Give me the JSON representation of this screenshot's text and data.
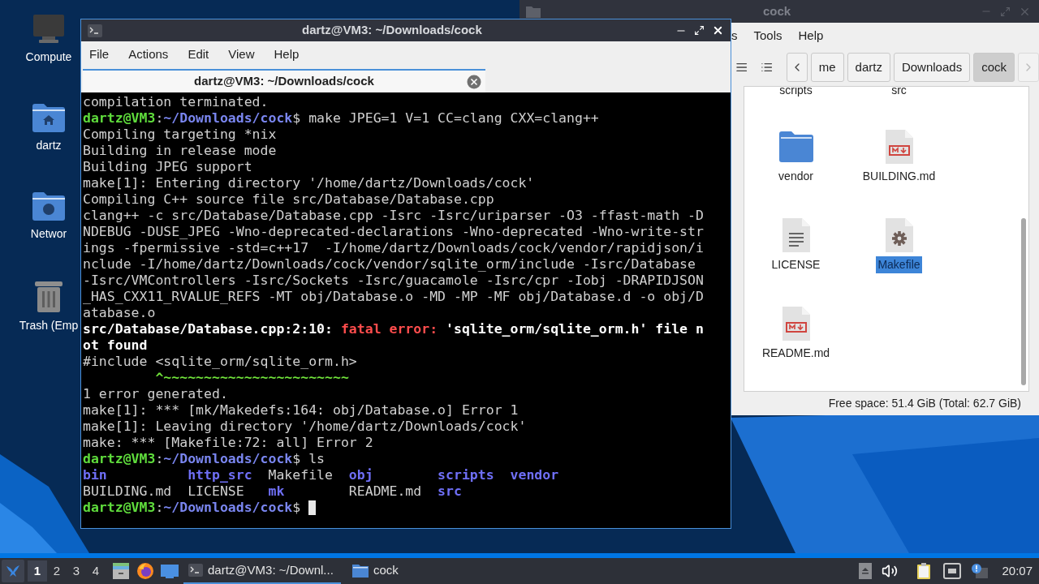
{
  "desktop_icons": [
    {
      "label": "Compute",
      "kind": "computer"
    },
    {
      "label": "dartz",
      "kind": "home"
    },
    {
      "label": "Networ",
      "kind": "network"
    },
    {
      "label": "Trash (Emp",
      "kind": "trash"
    }
  ],
  "file_manager": {
    "title": "cock",
    "menu": [
      "s",
      "Tools",
      "Help"
    ],
    "breadcrumbs": [
      {
        "label": "me",
        "selected": false
      },
      {
        "label": "dartz",
        "selected": false
      },
      {
        "label": "Downloads",
        "selected": false
      },
      {
        "label": "cock",
        "selected": true
      }
    ],
    "files": [
      {
        "name": "scripts",
        "kind": "label_only",
        "selected": false
      },
      {
        "name": "src",
        "kind": "label_only",
        "selected": false
      },
      {
        "name": "vendor",
        "kind": "folder",
        "selected": false
      },
      {
        "name": "BUILDING.md",
        "kind": "markdown",
        "selected": false
      },
      {
        "name": "LICENSE",
        "kind": "text",
        "selected": false
      },
      {
        "name": "Makefile",
        "kind": "makefile",
        "selected": true
      },
      {
        "name": "README.md",
        "kind": "markdown",
        "selected": false
      }
    ],
    "status": "Free space: 51.4 GiB (Total: 62.7 GiB)"
  },
  "terminal": {
    "title": "dartz@VM3: ~/Downloads/cock",
    "menu": [
      "File",
      "Actions",
      "Edit",
      "View",
      "Help"
    ],
    "tabs": [
      {
        "label": "dartz@VM3: ~/Downloads/cock",
        "selected": true
      }
    ],
    "lines": [
      [
        {
          "text": "compilation terminated.",
          "kind": "plain"
        }
      ],
      [
        {
          "text": "dartz@VM3",
          "kind": "user"
        },
        {
          "text": ":",
          "kind": "plain"
        },
        {
          "text": "~/Downloads/cock",
          "kind": "path"
        },
        {
          "text": "$ make JPEG=1 V=1 CC=clang CXX=clang++",
          "kind": "plain"
        }
      ],
      [
        {
          "text": "Compiling targeting *nix",
          "kind": "plain"
        }
      ],
      [
        {
          "text": "Building in release mode",
          "kind": "plain"
        }
      ],
      [
        {
          "text": "Building JPEG support",
          "kind": "plain"
        }
      ],
      [
        {
          "text": "make[1]: Entering directory '/home/dartz/Downloads/cock'",
          "kind": "plain"
        }
      ],
      [
        {
          "text": "Compiling C++ source file src/Database/Database.cpp",
          "kind": "plain"
        }
      ],
      [
        {
          "text": "clang++ -c src/Database/Database.cpp -Isrc -Isrc/uriparser -O3 -ffast-math -D",
          "kind": "plain"
        }
      ],
      [
        {
          "text": "NDEBUG -DUSE_JPEG -Wno-deprecated-declarations -Wno-deprecated -Wno-write-str",
          "kind": "plain"
        }
      ],
      [
        {
          "text": "ings -fpermissive -std=c++17  -I/home/dartz/Downloads/cock/vendor/rapidjson/i",
          "kind": "plain"
        }
      ],
      [
        {
          "text": "nclude -I/home/dartz/Downloads/cock/vendor/sqlite_orm/include -Isrc/Database",
          "kind": "plain"
        }
      ],
      [
        {
          "text": "-Isrc/VMControllers -Isrc/Sockets -Isrc/guacamole -Isrc/cpr -Iobj -DRAPIDJSON",
          "kind": "plain"
        }
      ],
      [
        {
          "text": "_HAS_CXX11_RVALUE_REFS -MT obj/Database.o -MD -MP -MF obj/Database.d -o obj/D",
          "kind": "plain"
        }
      ],
      [
        {
          "text": "atabase.o",
          "kind": "plain"
        }
      ],
      [
        {
          "text": "src/Database/Database.cpp:2:10: ",
          "kind": "bold"
        },
        {
          "text": "fatal error: ",
          "kind": "error"
        },
        {
          "text": "'sqlite_orm/sqlite_orm.h' file n",
          "kind": "bold"
        }
      ],
      [
        {
          "text": "ot found",
          "kind": "bold"
        }
      ],
      [
        {
          "text": "#include <sqlite_orm/sqlite_orm.h>",
          "kind": "plain"
        }
      ],
      [
        {
          "text": "         ^~~~~~~~~~~~~~~~~~~~~~~~",
          "kind": "caret"
        }
      ],
      [
        {
          "text": "1 error generated.",
          "kind": "plain"
        }
      ],
      [
        {
          "text": "make[1]: *** [mk/Makedefs:164: obj/Database.o] Error 1",
          "kind": "plain"
        }
      ],
      [
        {
          "text": "make[1]: Leaving directory '/home/dartz/Downloads/cock'",
          "kind": "plain"
        }
      ],
      [
        {
          "text": "make: *** [Makefile:72: all] Error 2",
          "kind": "plain"
        }
      ],
      [
        {
          "text": "dartz@VM3",
          "kind": "user"
        },
        {
          "text": ":",
          "kind": "plain"
        },
        {
          "text": "~/Downloads/cock",
          "kind": "path"
        },
        {
          "text": "$ ls",
          "kind": "plain"
        }
      ],
      [
        {
          "text": "bin          ",
          "kind": "dir"
        },
        {
          "text": "http_src  ",
          "kind": "dir"
        },
        {
          "text": "Makefile  ",
          "kind": "plain"
        },
        {
          "text": "obj        ",
          "kind": "dir"
        },
        {
          "text": "scripts  ",
          "kind": "dir"
        },
        {
          "text": "vendor",
          "kind": "dir"
        }
      ],
      [
        {
          "text": "BUILDING.md  LICENSE   ",
          "kind": "plain"
        },
        {
          "text": "mk",
          "kind": "dir"
        },
        {
          "text": "        README.md  ",
          "kind": "plain"
        },
        {
          "text": "src",
          "kind": "dir"
        }
      ],
      [
        {
          "text": "dartz@VM3",
          "kind": "user"
        },
        {
          "text": ":",
          "kind": "plain"
        },
        {
          "text": "~/Downloads/cock",
          "kind": "path"
        },
        {
          "text": "$ ",
          "kind": "plain"
        }
      ]
    ]
  },
  "taskbar": {
    "desktops": [
      {
        "label": "1",
        "selected": true
      },
      {
        "label": "2",
        "selected": false
      },
      {
        "label": "3",
        "selected": false
      },
      {
        "label": "4",
        "selected": false
      }
    ],
    "tasks": [
      {
        "label": "dartz@VM3: ~/Downl...",
        "kind": "terminal",
        "selected": true
      },
      {
        "label": "cock",
        "kind": "folder",
        "selected": false
      }
    ],
    "clock": "20:07"
  }
}
